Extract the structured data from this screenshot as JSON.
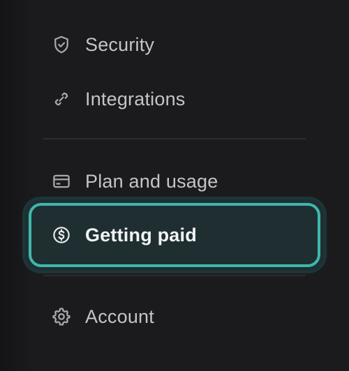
{
  "sidebar": {
    "items": [
      {
        "label": "Security",
        "icon": "shield-check-icon",
        "active": false
      },
      {
        "label": "Integrations",
        "icon": "link-icon",
        "active": false
      },
      {
        "label": "Plan and usage",
        "icon": "credit-card-icon",
        "active": false
      },
      {
        "label": "Getting paid",
        "icon": "dollar-circle-icon",
        "active": true
      },
      {
        "label": "Account",
        "icon": "gear-icon",
        "active": false
      }
    ]
  },
  "colors": {
    "background": "#1b1b1d",
    "active_background": "#1f2f31",
    "active_border": "#3fb7ae",
    "text": "#c4c4ca",
    "active_text": "#f3f3f5",
    "icon": "#a7a7ad",
    "divider": "#2d2d31"
  }
}
